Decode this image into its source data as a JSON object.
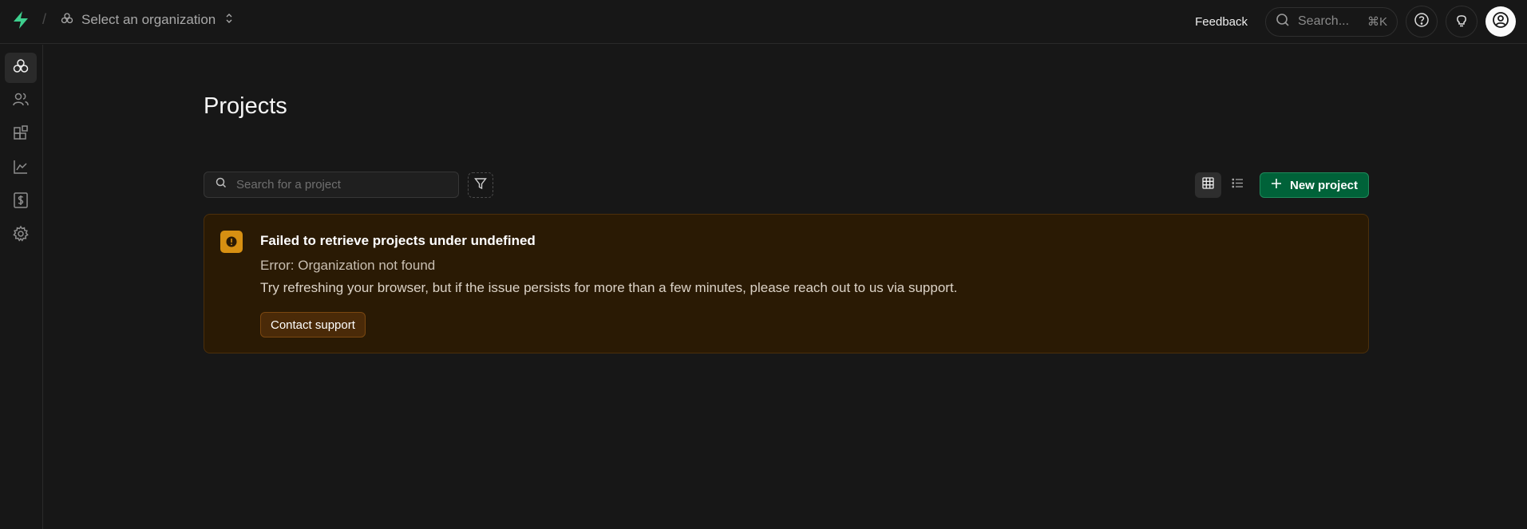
{
  "header": {
    "breadcrumb_separator": "/",
    "org_select_label": "Select an organization",
    "feedback_label": "Feedback",
    "search_placeholder": "Search...",
    "search_shortcut": "⌘K"
  },
  "sidebar": {
    "items": [
      {
        "icon": "projects-icon",
        "active": true
      },
      {
        "icon": "team-icon",
        "active": false
      },
      {
        "icon": "integrations-icon",
        "active": false
      },
      {
        "icon": "usage-chart-icon",
        "active": false
      },
      {
        "icon": "billing-icon",
        "active": false
      },
      {
        "icon": "settings-gear-icon",
        "active": false
      }
    ]
  },
  "main": {
    "title": "Projects",
    "search_placeholder": "Search for a project",
    "new_project_label": "New project",
    "alert": {
      "title": "Failed to retrieve projects under undefined",
      "line1": "Error: Organization not found",
      "line2": "Try refreshing your browser, but if the issue persists for more than a few minutes, please reach out to us via support.",
      "button_label": "Contact support"
    }
  },
  "colors": {
    "background": "#171717",
    "brand_green": "#3ecf8e",
    "primary_button": "#006239",
    "warning_bg": "#2a1a04",
    "warning_icon": "#d79012"
  }
}
